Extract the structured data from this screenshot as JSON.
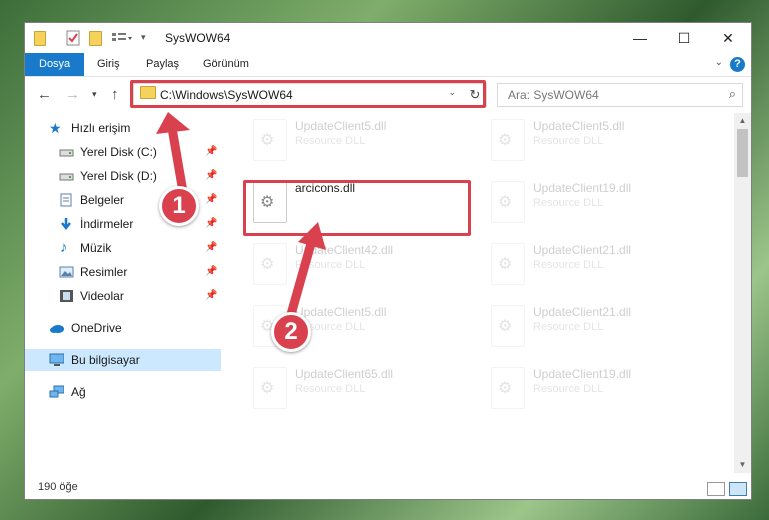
{
  "window": {
    "title": "SysWOW64",
    "minimize_label": "—",
    "maximize_label": "☐",
    "close_label": "✕"
  },
  "ribbon": {
    "tabs": [
      "Dosya",
      "Giriş",
      "Paylaş",
      "Görünüm"
    ],
    "help_label": "?",
    "collapse_label": "⌄"
  },
  "address": {
    "path": "C:\\Windows\\SysWOW64",
    "search_placeholder": "Ara: SysWOW64"
  },
  "nav": {
    "quick_access": "Hızlı erişim",
    "items": [
      {
        "label": "Yerel Disk (C:)",
        "icon": "drive-icon",
        "pinned": true
      },
      {
        "label": "Yerel Disk (D:)",
        "icon": "drive-icon",
        "pinned": true
      },
      {
        "label": "Belgeler",
        "icon": "documents-icon",
        "pinned": true
      },
      {
        "label": "İndirmeler",
        "icon": "downloads-icon",
        "pinned": true
      },
      {
        "label": "Müzik",
        "icon": "music-icon",
        "pinned": true
      },
      {
        "label": "Resimler",
        "icon": "pictures-icon",
        "pinned": true
      },
      {
        "label": "Videolar",
        "icon": "videos-icon",
        "pinned": true
      }
    ],
    "onedrive": "OneDrive",
    "this_pc": "Bu bilgisayar",
    "network": "Ağ"
  },
  "files": {
    "left": [
      {
        "name": "UpdateClient5.dll",
        "desc": "Resource DLL",
        "faded": true
      },
      {
        "name": "arcicons.dll",
        "desc": "",
        "faded": false
      },
      {
        "name": "UpdateClient42.dll",
        "desc": "Resource DLL",
        "faded": true
      },
      {
        "name": "UpdateClient5.dll",
        "desc": "Resource DLL",
        "faded": true
      },
      {
        "name": "UpdateClient65.dll",
        "desc": "Resource DLL",
        "faded": true
      }
    ],
    "right": [
      {
        "name": "UpdateClient5.dll",
        "desc": "Resource DLL",
        "faded": true
      },
      {
        "name": "UpdateClient19.dll",
        "desc": "Resource DLL",
        "faded": true
      },
      {
        "name": "UpdateClient21.dll",
        "desc": "Resource DLL",
        "faded": true
      },
      {
        "name": "UpdateClient21.dll",
        "desc": "Resource DLL",
        "faded": true
      },
      {
        "name": "UpdateClient19.dll",
        "desc": "Resource DLL",
        "faded": true
      }
    ]
  },
  "status": {
    "count": "190 öğe"
  },
  "callouts": {
    "one": "1",
    "two": "2"
  },
  "colors": {
    "accent": "#1979ca",
    "highlight": "#d9414e",
    "selected": "#cce8ff"
  }
}
